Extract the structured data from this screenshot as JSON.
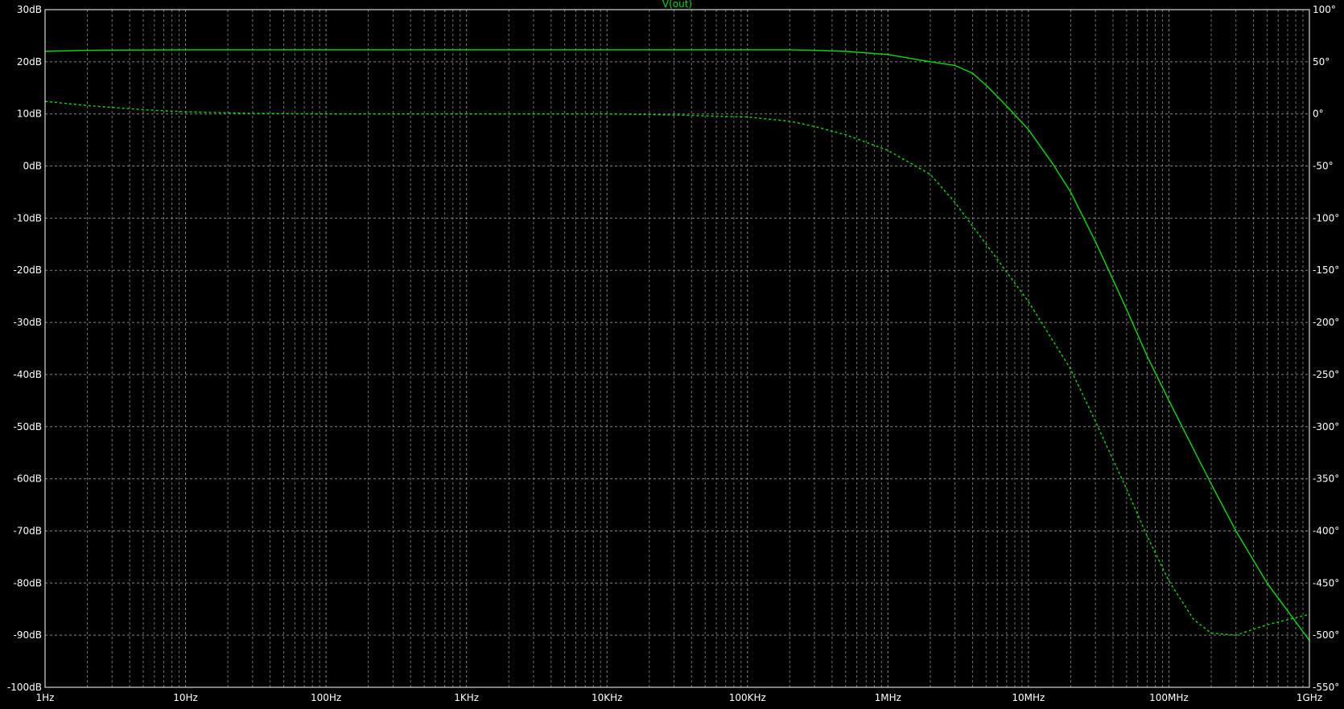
{
  "colors": {
    "background": "#000000",
    "grid": "#9a9a9a",
    "frame": "#ffffff",
    "tick_text": "#ffffff",
    "trace": "#00e000"
  },
  "chart_data": {
    "type": "line",
    "title": "V(out)",
    "x_scale": "log",
    "xlim": [
      1,
      1000000000
    ],
    "x_ticks": [
      {
        "value": 1,
        "label": "1Hz"
      },
      {
        "value": 10,
        "label": "10Hz"
      },
      {
        "value": 100,
        "label": "100Hz"
      },
      {
        "value": 1000,
        "label": "1KHz"
      },
      {
        "value": 10000,
        "label": "10KHz"
      },
      {
        "value": 100000,
        "label": "100KHz"
      },
      {
        "value": 1000000,
        "label": "1MHz"
      },
      {
        "value": 10000000,
        "label": "10MHz"
      },
      {
        "value": 100000000,
        "label": "100MHz"
      },
      {
        "value": 1000000000,
        "label": "1GHz"
      }
    ],
    "ylim_left": [
      -100,
      30
    ],
    "y_ticks_left": [
      {
        "value": 30,
        "label": "30dB"
      },
      {
        "value": 20,
        "label": "20dB"
      },
      {
        "value": 10,
        "label": "10dB"
      },
      {
        "value": 0,
        "label": "0dB"
      },
      {
        "value": -10,
        "label": "-10dB"
      },
      {
        "value": -20,
        "label": "-20dB"
      },
      {
        "value": -30,
        "label": "-30dB"
      },
      {
        "value": -40,
        "label": "-40dB"
      },
      {
        "value": -50,
        "label": "-50dB"
      },
      {
        "value": -60,
        "label": "-60dB"
      },
      {
        "value": -70,
        "label": "-70dB"
      },
      {
        "value": -80,
        "label": "-80dB"
      },
      {
        "value": -90,
        "label": "-90dB"
      },
      {
        "value": -100,
        "label": "-100dB"
      }
    ],
    "ylim_right": [
      -550,
      100
    ],
    "y_ticks_right": [
      {
        "value": 100,
        "label": "100°"
      },
      {
        "value": 50,
        "label": "50°"
      },
      {
        "value": 0,
        "label": "0°"
      },
      {
        "value": -50,
        "label": "-50°"
      },
      {
        "value": -100,
        "label": "-100°"
      },
      {
        "value": -150,
        "label": "-150°"
      },
      {
        "value": -200,
        "label": "-200°"
      },
      {
        "value": -250,
        "label": "-250°"
      },
      {
        "value": -300,
        "label": "-300°"
      },
      {
        "value": -350,
        "label": "-350°"
      },
      {
        "value": -400,
        "label": "-400°"
      },
      {
        "value": -450,
        "label": "-450°"
      },
      {
        "value": -500,
        "label": "-500°"
      },
      {
        "value": -550,
        "label": "-550°"
      }
    ],
    "grid": true,
    "series": [
      {
        "kind": "magnitude",
        "axis": "left",
        "style": "solid",
        "x": [
          1,
          2,
          10,
          100,
          1000,
          10000,
          100000,
          200000,
          300000,
          500000,
          1000000,
          2000000,
          3000000,
          4000000,
          5000000,
          7000000,
          10000000,
          15000000,
          20000000,
          30000000,
          50000000,
          70000000,
          100000000,
          200000000,
          300000000,
          500000000,
          1000000000
        ],
        "y": [
          22,
          22.2,
          22.3,
          22.3,
          22.3,
          22.3,
          22.3,
          22.3,
          22.2,
          22.0,
          21.4,
          20.0,
          19.3,
          17.8,
          15.5,
          11.5,
          7.0,
          0.3,
          -5.0,
          -14.5,
          -27.5,
          -36.5,
          -45.0,
          -61.0,
          -70.0,
          -80.0,
          -91.0
        ]
      },
      {
        "kind": "phase",
        "axis": "right",
        "style": "dashed",
        "x": [
          1,
          2,
          5,
          10,
          30,
          100,
          1000,
          10000,
          30000,
          100000,
          200000,
          300000,
          500000,
          1000000,
          2000000,
          3000000,
          5000000,
          10000000,
          20000000,
          30000000,
          50000000,
          70000000,
          100000000,
          150000000,
          200000000,
          300000000,
          500000000,
          1000000000
        ],
        "y": [
          12,
          8,
          4,
          2,
          0.5,
          0,
          0,
          0,
          -1,
          -3,
          -7,
          -12,
          -20,
          -35,
          -58,
          -85,
          -125,
          -180,
          -245,
          -295,
          -360,
          -405,
          -448,
          -485,
          -498,
          -500,
          -490,
          -480
        ]
      }
    ]
  }
}
